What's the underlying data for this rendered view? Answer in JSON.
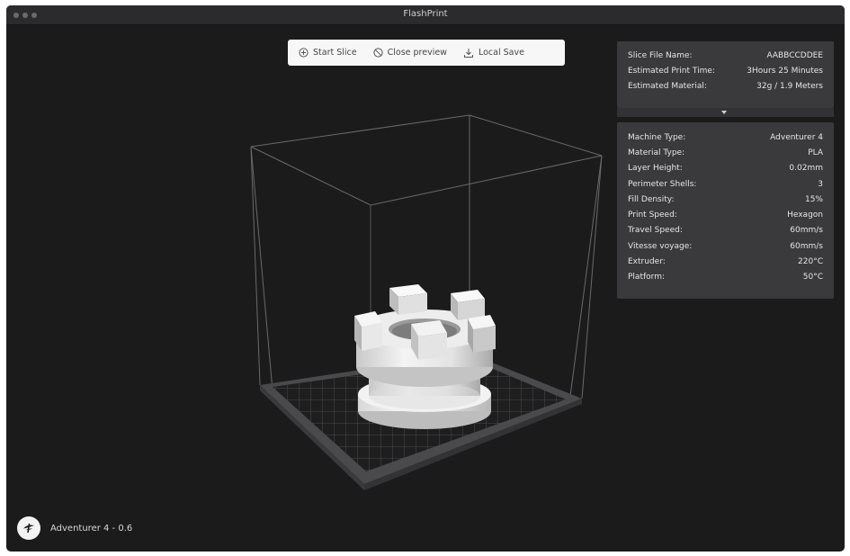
{
  "window": {
    "title": "FlashPrint"
  },
  "toolbar": {
    "start_slice": "Start Slice",
    "close_preview": "Close preview",
    "local_save": "Local Save"
  },
  "slice_info": [
    {
      "label": "Slice File Name:",
      "value": "AABBCCDDEE"
    },
    {
      "label": "Estimated Print Time:",
      "value": "3Hours 25 Minutes"
    },
    {
      "label": "Estimated Material:",
      "value": "32g / 1.9 Meters"
    }
  ],
  "settings": [
    {
      "label": "Machine Type:",
      "value": "Adventurer 4"
    },
    {
      "label": "Material Type:",
      "value": "PLA"
    },
    {
      "label": "Layer Height:",
      "value": "0.02mm"
    },
    {
      "label": "Perimeter Shells:",
      "value": "3"
    },
    {
      "label": "Fill Density:",
      "value": "15%"
    },
    {
      "label": "Print Speed:",
      "value": "Hexagon"
    },
    {
      "label": "Travel Speed:",
      "value": "60mm/s"
    },
    {
      "label": "Vitesse voyage:",
      "value": "60mm/s"
    },
    {
      "label": "Extruder:",
      "value": "220°C"
    },
    {
      "label": "Platform:",
      "value": "50°C"
    }
  ],
  "footer": {
    "machine": "Adventurer 4 - 0.6"
  },
  "icons": {
    "start_slice": "circle-plus-icon",
    "close_preview": "circle-slash-icon",
    "local_save": "download-icon",
    "logo": "flashforge-logo-icon"
  },
  "colors": {
    "background": "#1b1b1c",
    "panel": "#3a3a3c",
    "toolbar": "#f7f7f7"
  }
}
